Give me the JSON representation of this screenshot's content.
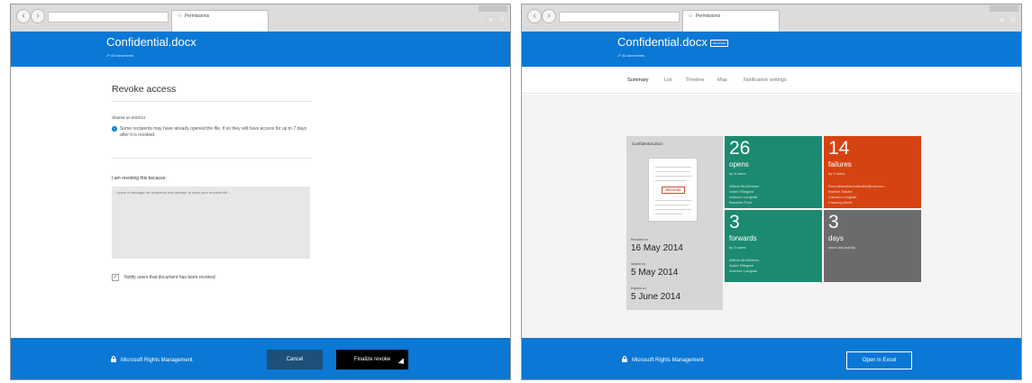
{
  "browser": {
    "tab_title": "Permissions",
    "tab_icon": "user-group-icon",
    "back_glyph": "‹",
    "forward_glyph": "›",
    "chrome_icons": "⌂ ★ ⚙"
  },
  "revoke": {
    "header": {
      "title": "Confidential.docx",
      "breadcrumb": "⤺ All documents"
    },
    "panel_title": "Revoke access",
    "shared_on": "Shared on 9/23/14",
    "info_icon_glyph": "i",
    "info_text": "Some recipients may have already opened the file, if so they will have access for up to 7 days after it is revoked.",
    "reason_label": "I am revoking this because:",
    "reason_placeholder": "Leave a message for recipients who attempt to open your revoked file...",
    "notify_label": "Notify users that document has been revoked",
    "notify_checked_glyph": "✓",
    "footer": {
      "brand": "Microsoft Rights Management",
      "cancel_label": "Cancel",
      "finalize_label": "Finalize revoke"
    }
  },
  "summary": {
    "header": {
      "title": "Confidential.docx",
      "badge": "REVOKED",
      "breadcrumb": "⤺ All documents"
    },
    "tabs": [
      {
        "label": "Summary",
        "active": true
      },
      {
        "label": "List",
        "active": false
      },
      {
        "label": "Timeline",
        "active": false
      },
      {
        "label": "Map",
        "active": false
      },
      {
        "label": "Notification settings",
        "active": false
      }
    ],
    "doc_card": {
      "title": "Confidential.docx",
      "stamp": "REVOKED",
      "revoked_label": "Revoked on",
      "revoked_date": "16 May 2014",
      "shared_label": "Shared on",
      "shared_date": "5 May 2014",
      "expires_label": "Expires on",
      "expires_date": "5 June 2014"
    },
    "tiles": {
      "opens": {
        "count": "26",
        "label": "opens",
        "sub": "by 5 users",
        "users": [
          "Affleck McGibbons",
          "Arden Fillegree",
          "Aamson Longhair",
          "Basmine Post"
        ],
        "color": "#1b8a70"
      },
      "failures": {
        "count": "14",
        "label": "failures",
        "sub": "by 3 users",
        "users": [
          "Roundslandistributionlist@microso...",
          "Brother Twister",
          "Camson Longhair",
          "Clancing Monk"
        ],
        "color": "#d64312"
      },
      "forwards": {
        "count": "3",
        "label": "forwards",
        "sub": "by 3 users",
        "users": [
          "Affleck McGibbons",
          "Arden Fillegree",
          "Aamson Longhair"
        ],
        "color": "#1b8a70"
      },
      "days": {
        "count": "3",
        "label": "days",
        "sub": "since last activity",
        "color": "#6b6b6b"
      }
    },
    "footer": {
      "brand": "Microsoft Rights Management",
      "excel_label": "Open in Excel"
    }
  },
  "colors": {
    "accent": "#0a78d4",
    "green": "#1b8a70",
    "orange": "#d64312",
    "gray": "#6b6b6b"
  }
}
